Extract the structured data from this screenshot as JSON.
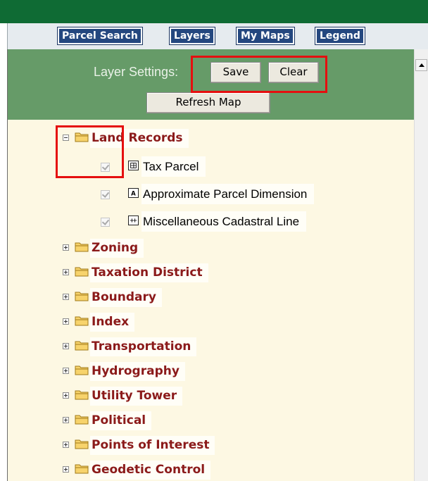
{
  "nav": {
    "tabs": [
      {
        "label": "Parcel Search"
      },
      {
        "label": "Layers"
      },
      {
        "label": "My Maps"
      },
      {
        "label": "Legend"
      }
    ]
  },
  "layer_settings": {
    "label": "Layer Settings:",
    "save_label": "Save",
    "clear_label": "Clear",
    "refresh_label": "Refresh Map"
  },
  "tree": {
    "expanded_group": {
      "label": "Land Records",
      "expanded": true,
      "layers": [
        {
          "label": "Tax Parcel",
          "checked": true,
          "icon": "parcel-layer-icon"
        },
        {
          "label": "Approximate Parcel Dimension",
          "checked": true,
          "icon": "annotation-a-icon"
        },
        {
          "label": "Miscellaneous Cadastral Line",
          "checked": true,
          "icon": "line-layer-icon"
        }
      ]
    },
    "collapsed_groups": [
      {
        "label": "Zoning"
      },
      {
        "label": "Taxation District"
      },
      {
        "label": "Boundary"
      },
      {
        "label": "Index"
      },
      {
        "label": "Transportation"
      },
      {
        "label": "Hydrography"
      },
      {
        "label": "Utility Tower"
      },
      {
        "label": "Political"
      },
      {
        "label": "Points of Interest"
      },
      {
        "label": "Geodetic Control"
      }
    ]
  },
  "colors": {
    "header_green": "#0f6b34",
    "settings_green": "#669b68",
    "tab_blue": "#24477f",
    "group_label_red": "#8b1a1a",
    "tree_background": "#fdf8e3",
    "highlight_red": "#e50f0f"
  }
}
